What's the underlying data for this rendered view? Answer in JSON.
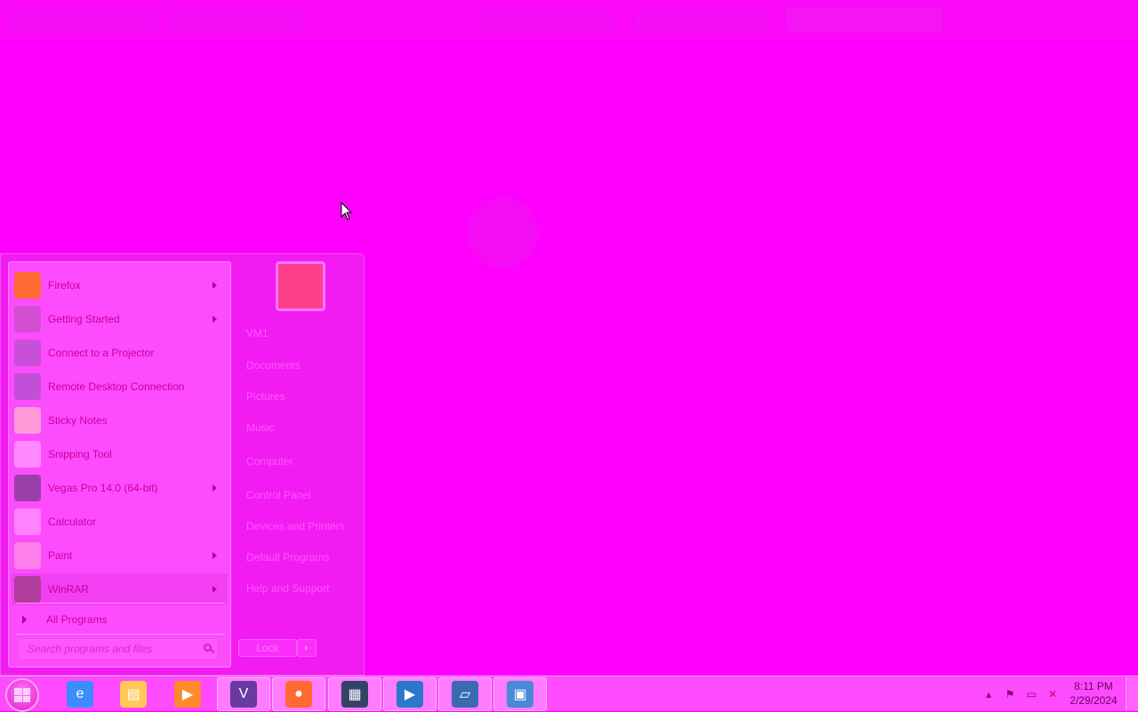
{
  "start_menu": {
    "programs": [
      {
        "label": "Firefox",
        "icon": "firefox-icon",
        "color": "#ff6a33",
        "has_submenu": true
      },
      {
        "label": "Getting Started",
        "icon": "getting-started-icon",
        "color": "#d24fd2",
        "has_submenu": true
      },
      {
        "label": "Connect to a Projector",
        "icon": "projector-icon",
        "color": "#c84fd8",
        "has_submenu": false
      },
      {
        "label": "Remote Desktop Connection",
        "icon": "remote-desktop-icon",
        "color": "#c24fd8",
        "has_submenu": false
      },
      {
        "label": "Sticky Notes",
        "icon": "sticky-notes-icon",
        "color": "#ff9ad4",
        "has_submenu": false
      },
      {
        "label": "Snipping Tool",
        "icon": "snipping-tool-icon",
        "color": "#ff8aff",
        "has_submenu": false
      },
      {
        "label": "Vegas Pro 14.0 (64-bit)",
        "icon": "vegas-pro-icon",
        "color": "#9a40aa",
        "has_submenu": true
      },
      {
        "label": "Calculator",
        "icon": "calculator-icon",
        "color": "#ff82ff",
        "has_submenu": false
      },
      {
        "label": "Paint",
        "icon": "paint-icon",
        "color": "#ff7fe8",
        "has_submenu": true
      },
      {
        "label": "WinRAR",
        "icon": "winrar-icon",
        "color": "#b03d9e",
        "has_submenu": true
      }
    ],
    "all_programs_label": "All Programs",
    "search_placeholder": "Search programs and files",
    "right_items": [
      {
        "label": "VM1"
      },
      {
        "label": "Documents"
      },
      {
        "label": "Pictures"
      },
      {
        "label": "Music"
      },
      {
        "label": "Computer"
      },
      {
        "label": "Control Panel"
      },
      {
        "label": "Devices and Printers"
      },
      {
        "label": "Default Programs"
      },
      {
        "label": "Help and Support"
      }
    ],
    "lock_label": "Lock"
  },
  "taskbar": {
    "pinned": [
      {
        "name": "internet-explorer-icon",
        "glyph": "e",
        "color": "#3a8cff",
        "active": false
      },
      {
        "name": "file-explorer-icon",
        "glyph": "▤",
        "color": "#ffc857",
        "active": false
      },
      {
        "name": "media-player-icon",
        "glyph": "▶",
        "color": "#ff8a2a",
        "active": false
      },
      {
        "name": "vegas-pro-icon",
        "glyph": "V",
        "color": "#6a3aa0",
        "active": true
      },
      {
        "name": "firefox-icon",
        "glyph": "●",
        "color": "#ff6a33",
        "active": true
      },
      {
        "name": "movie-maker-icon",
        "glyph": "▦",
        "color": "#334466",
        "active": true
      },
      {
        "name": "player-icon",
        "glyph": "▶",
        "color": "#2a78c8",
        "active": true
      },
      {
        "name": "remote-app-icon",
        "glyph": "▱",
        "color": "#3a6ab0",
        "active": true
      },
      {
        "name": "control-panel-icon",
        "glyph": "▣",
        "color": "#4a88d8",
        "active": true
      }
    ],
    "tray_icons": [
      "show-hidden-icons",
      "action-center-flag-icon",
      "network-icon",
      "volume-muted-icon"
    ],
    "clock": {
      "time": "8:11 PM",
      "date": "2/29/2024"
    }
  }
}
